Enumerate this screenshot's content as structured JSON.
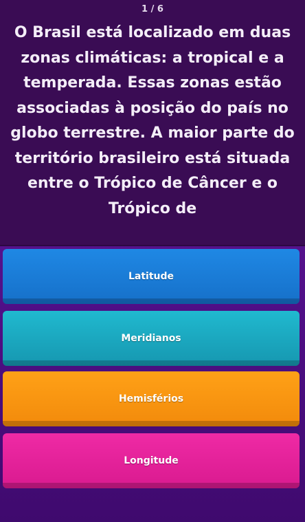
{
  "progress": "1 / 6",
  "question": "O Brasil está localizado em duas zonas climáticas: a tropical e a temperada. Essas zonas estão associadas à posição do país no globo terrestre. A maior parte do território brasileiro está situada entre o Trópico de Câncer e o Trópico de",
  "answers": [
    {
      "label": "Latitude",
      "color": "#1f88e4"
    },
    {
      "label": "Meridianos",
      "color": "#20b9cf"
    },
    {
      "label": "Hemisférios",
      "color": "#ffa117"
    },
    {
      "label": "Longitude",
      "color": "#ef2aa5"
    }
  ]
}
